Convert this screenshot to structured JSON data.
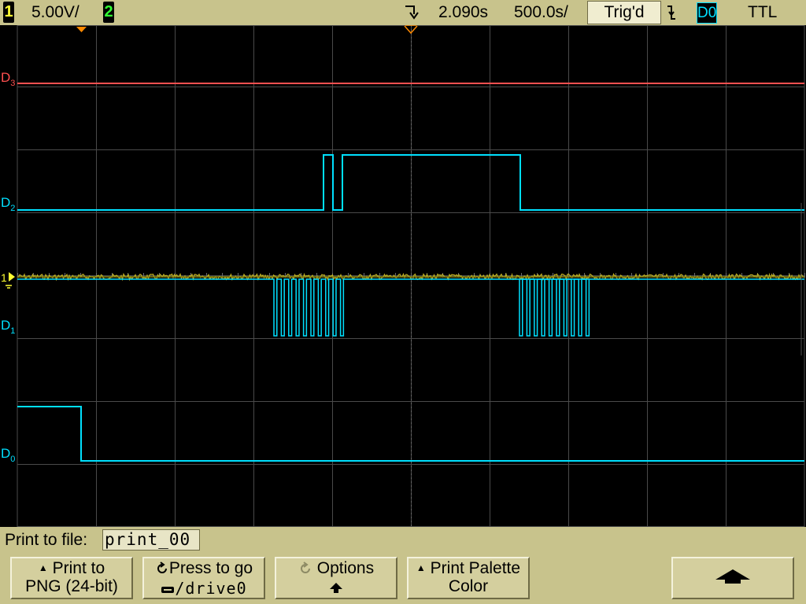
{
  "topbar": {
    "ch1_number": "1",
    "ch1_scale": "5.00V/",
    "ch2_number": "2",
    "delay": "2.090s",
    "timebase": "500.0s/",
    "trigger_status": "Trig'd",
    "trigger_source": "D0",
    "trigger_level": "TTL",
    "ch1_color": "#ffff33",
    "ch2_color": "#33ff33",
    "digital_color": "#00e0ff"
  },
  "channels": {
    "d3_label": "D3",
    "d2_label": "D2",
    "d1_label": "D1",
    "d0_label": "D0",
    "analog1_label": "1",
    "d3_color": "#ff5050",
    "analog1_color": "#d0c020"
  },
  "bottom": {
    "print_to_file_label": "Print to file:",
    "print_to_file_value": "print_00",
    "softkey1": {
      "line1": "Print to",
      "line2": "PNG (24-bit)"
    },
    "softkey2": {
      "line1": "Press to go",
      "line2": "/drive0"
    },
    "softkey3": {
      "line1": "Options",
      "icon": "up-arrow-icon"
    },
    "softkey4": {
      "line1": "Print Palette",
      "line2": "Color"
    },
    "softkey6": {
      "icon": "up-arrow-large-icon"
    }
  }
}
